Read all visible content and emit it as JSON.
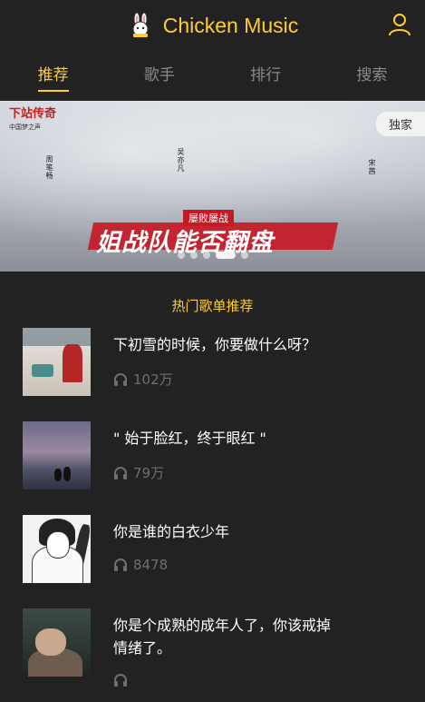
{
  "header": {
    "title": "Chicken Music",
    "logo_icon": "rabbit-logo-icon",
    "user_icon": "user-icon",
    "accent_color": "#ffcd32"
  },
  "tabs": [
    {
      "label": "推荐",
      "active": true
    },
    {
      "label": "歌手",
      "active": false
    },
    {
      "label": "排行",
      "active": false
    },
    {
      "label": "搜索",
      "active": false
    }
  ],
  "banner": {
    "badge": "独家",
    "logo_text": "下站传奇",
    "logo_sub": "中国梦之声",
    "names": [
      "周笔畅",
      "吴亦凡",
      "宋茜"
    ],
    "slogan_sub": "屡败屡战",
    "slogan": "姐战队能否翻盘",
    "slides_count": 5,
    "active_slide": 4
  },
  "section": {
    "title": "热门歌单推荐"
  },
  "playlists": [
    {
      "name": "下初雪的时候，你要做什么呀？",
      "plays": "102万"
    },
    {
      "name": "\" 始于脸红，终于眼红 \"",
      "plays": "79万"
    },
    {
      "name": "你是谁的白衣少年",
      "plays": "8478"
    },
    {
      "name": "你是个成熟的成年人了，你该戒掉情绪了。",
      "plays": ""
    }
  ],
  "icons": {
    "plays_icon": "headphones-icon"
  }
}
